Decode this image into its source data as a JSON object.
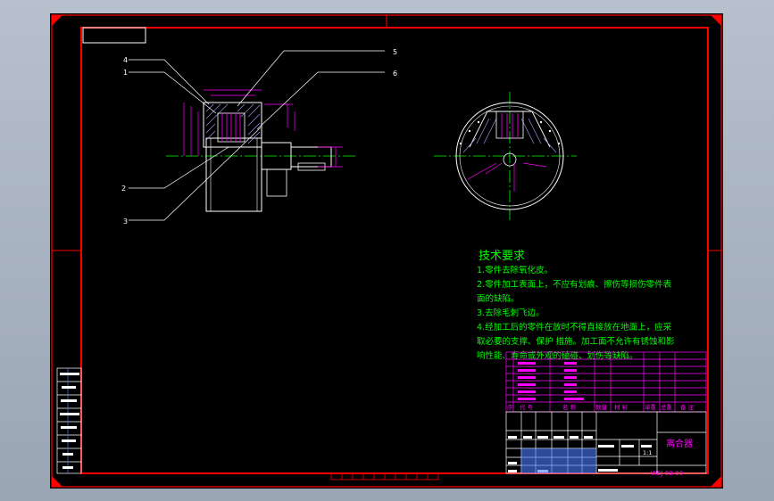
{
  "drawing": {
    "balloons": [
      "4",
      "1",
      "5",
      "6",
      "2",
      "3"
    ],
    "tech_requirements": {
      "title": "技术要求",
      "lines": [
        "1.零件去除氧化皮。",
        "2.零件加工表面上，不应有划痕、擦伤等损伤零件表",
        "面的缺陷。",
        "3.去除毛刺飞边。",
        "4.经加工后的零件在放时不得直接放在地面上，应采",
        "取必要的支撑、保护 措施。加工面不允许有锈蚀和影",
        "响性能、寿命或外观的磕碰、划伤等缺陷。"
      ]
    },
    "title_block": {
      "name": "离合器",
      "drawing_no": "WEJ-03-00",
      "scale": "1:1",
      "bom_headers": [
        "序",
        "代 号",
        "名 称",
        "数量",
        "材 料",
        "单重",
        "总重",
        "备 注"
      ]
    }
  },
  "colors": {
    "frame": "#ff0000",
    "outline": "#ffffff",
    "dimension": "#ff00ff",
    "centerline": "#00ff00",
    "text": "#00ff00",
    "table": "#ff00ff",
    "hatch": "#a0a0ff",
    "leader": "#ffffff"
  }
}
